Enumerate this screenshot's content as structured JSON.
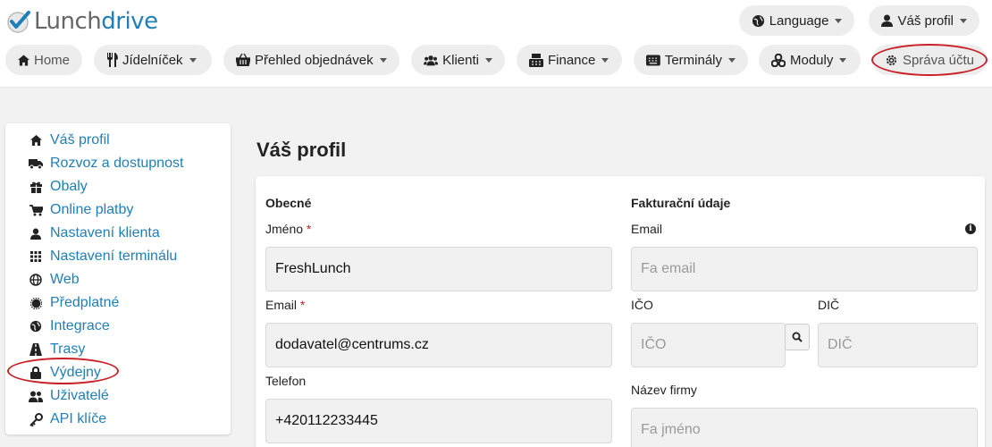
{
  "brand": {
    "part1": "Lunch",
    "part2": "drive"
  },
  "top": {
    "language": "Language",
    "profile": "Váš profil"
  },
  "nav": {
    "home": "Home",
    "menu": "Jídelníček",
    "orders": "Přehled objednávek",
    "clients": "Klienti",
    "finance": "Finance",
    "terminals": "Terminály",
    "modules": "Moduly",
    "account": "Správa účtu"
  },
  "sidebar": {
    "items": [
      {
        "label": "Váš profil",
        "icon": "home-icon"
      },
      {
        "label": "Rozvoz a dostupnost",
        "icon": "truck-icon"
      },
      {
        "label": "Obaly",
        "icon": "gift-icon"
      },
      {
        "label": "Online platby",
        "icon": "cart-icon"
      },
      {
        "label": "Nastavení klienta",
        "icon": "user-icon"
      },
      {
        "label": "Nastavení terminálu",
        "icon": "grid-icon"
      },
      {
        "label": "Web",
        "icon": "globe-icon"
      },
      {
        "label": "Předplatné",
        "icon": "certificate-icon"
      },
      {
        "label": "Integrace",
        "icon": "globe-americas-icon"
      },
      {
        "label": "Trasy",
        "icon": "road-icon"
      },
      {
        "label": "Výdejny",
        "icon": "lock-icon"
      },
      {
        "label": "Uživatelé",
        "icon": "users-icon"
      },
      {
        "label": "API klíče",
        "icon": "key-icon"
      }
    ]
  },
  "page": {
    "title": "Váš profil"
  },
  "form": {
    "general": {
      "title": "Obecné",
      "name_label": "Jméno",
      "name_value": "FreshLunch",
      "email_label": "Email",
      "email_value": "dodavatel@centrums.cz",
      "phone_label": "Telefon",
      "phone_value": "+420112233445",
      "required_mark": "*"
    },
    "billing": {
      "title": "Fakturační údaje",
      "email_label": "Email",
      "email_placeholder": "Fa email",
      "ico_label": "IČO",
      "ico_placeholder": "IČO",
      "dic_label": "DIČ",
      "dic_placeholder": "DIČ",
      "company_label": "Název firmy",
      "company_placeholder": "Fa jméno",
      "info_glyph": "i"
    }
  },
  "colors": {
    "link": "#1f7fb7",
    "highlight": "#c82127"
  }
}
